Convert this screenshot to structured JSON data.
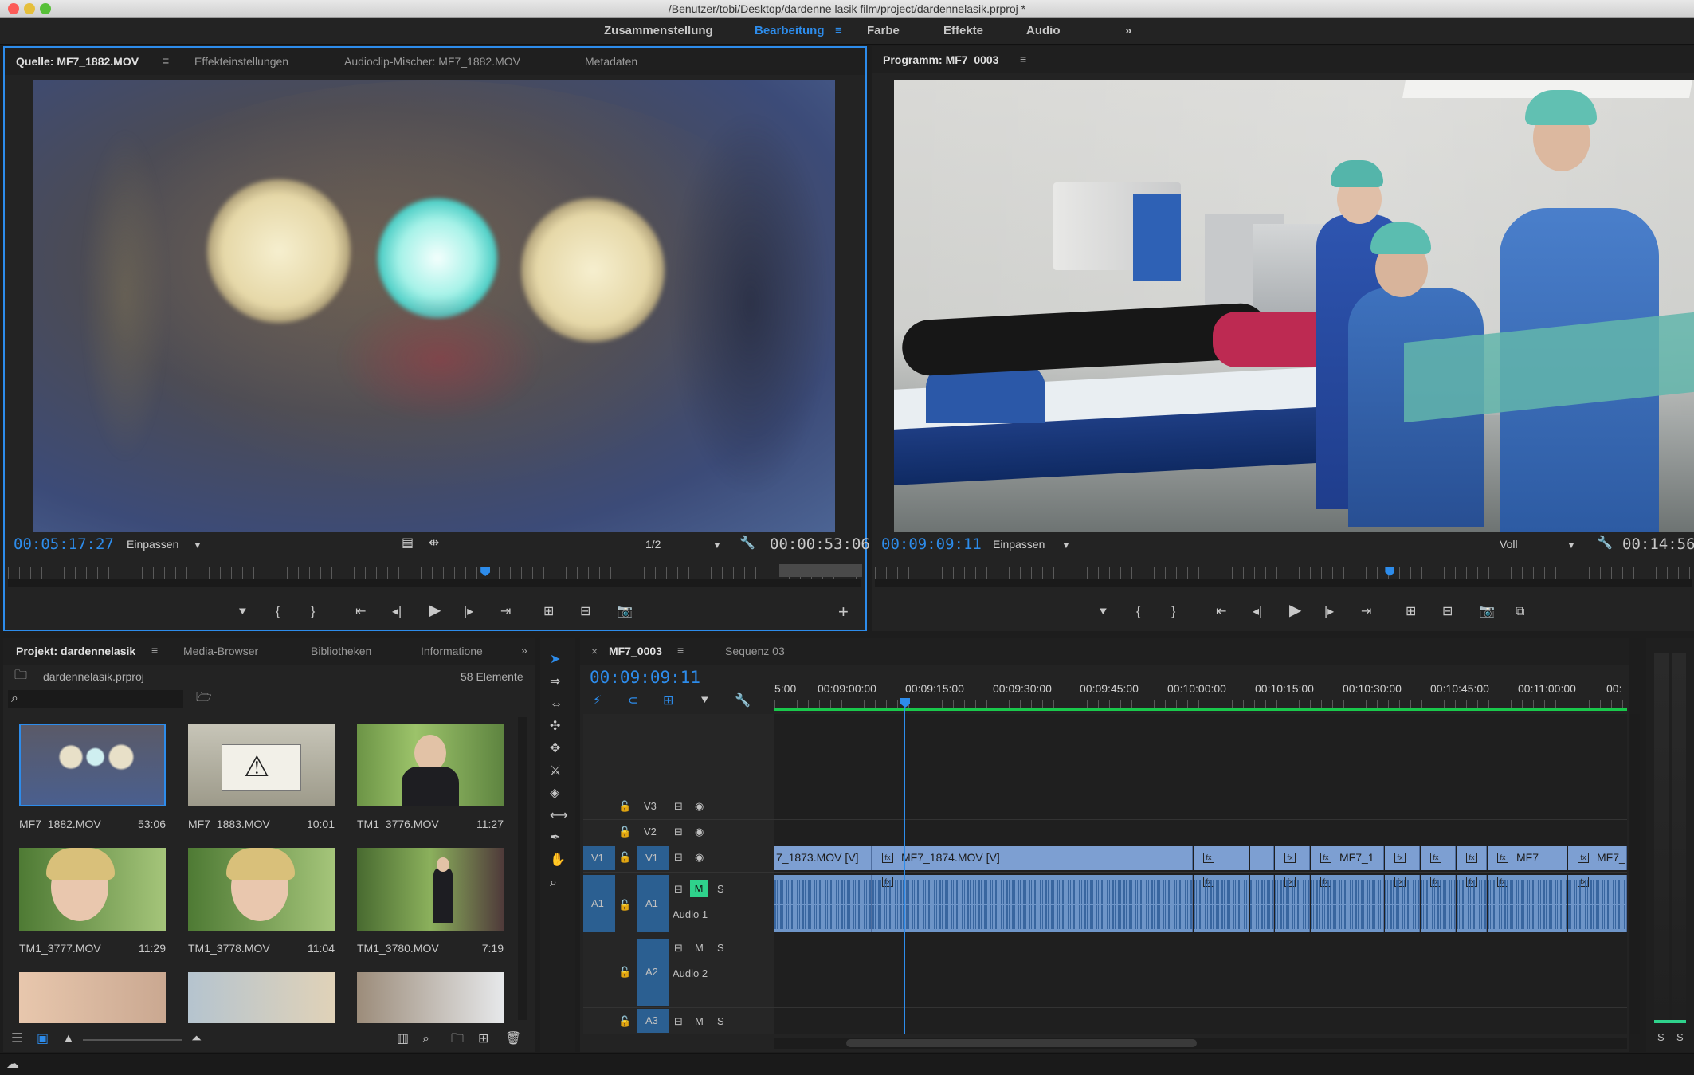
{
  "window": {
    "title": "/Benutzer/tobi/Desktop/dardenne lasik film/project/dardennelasik.prproj *"
  },
  "workspaces": {
    "items": [
      "Zusammenstellung",
      "Bearbeitung",
      "Farbe",
      "Effekte",
      "Audio"
    ],
    "active": "Bearbeitung",
    "more": "»"
  },
  "source": {
    "tabs": [
      "Quelle: MF7_1882.MOV",
      "Effekteinstellungen",
      "Audioclip-Mischer: MF7_1882.MOV",
      "Metadaten"
    ],
    "timecode": "00:05:17:27",
    "fit": "Einpassen",
    "resolution": "1/2",
    "duration": "00:00:53:06",
    "playhead_fraction": 0.56
  },
  "program": {
    "title": "Programm: MF7_0003",
    "timecode": "00:09:09:11",
    "fit": "Einpassen",
    "resolution": "Voll",
    "duration": "00:14:56:",
    "playhead_fraction": 0.63
  },
  "project": {
    "tabs": [
      "Projekt: dardennelasik",
      "Media-Browser",
      "Bibliotheken",
      "Informatione"
    ],
    "file": "dardennelasik.prproj",
    "count": "58 Elemente",
    "items": [
      {
        "name": "MF7_1882.MOV",
        "duration": "53:06"
      },
      {
        "name": "MF7_1883.MOV",
        "duration": "10:01"
      },
      {
        "name": "TM1_3776.MOV",
        "duration": "11:27"
      },
      {
        "name": "TM1_3777.MOV",
        "duration": "11:29"
      },
      {
        "name": "TM1_3778.MOV",
        "duration": "11:04"
      },
      {
        "name": "TM1_3780.MOV",
        "duration": "7:19"
      }
    ]
  },
  "timeline": {
    "tabs": [
      "MF7_0003",
      "Sequenz 03"
    ],
    "timecode": "00:09:09:11",
    "ruler": [
      "5:00",
      "00:09:00:00",
      "00:09:15:00",
      "00:09:30:00",
      "00:09:45:00",
      "00:10:00:00",
      "00:10:15:00",
      "00:10:30:00",
      "00:10:45:00",
      "00:11:00:00",
      "00:"
    ],
    "tracks": {
      "v3": "V3",
      "v2": "V2",
      "v1": "V1",
      "v1src": "V1",
      "a1": "A1",
      "a1src": "A1",
      "a1name": "Audio 1",
      "a2": "A2",
      "a2name": "Audio 2",
      "a3": "A3",
      "m": "M",
      "s": "S"
    },
    "clips": [
      "7_1873.MOV [V]",
      "MF7_1874.MOV [V]",
      "MF7_1",
      "MF7",
      "MF7_"
    ]
  },
  "meter": {
    "labels": [
      "S",
      "S"
    ]
  },
  "colors": {
    "accent": "#2d8ceb",
    "video_clip": "#7d9fd2",
    "audio_clip": "#6e95c8",
    "render_bar": "#19c84b"
  }
}
